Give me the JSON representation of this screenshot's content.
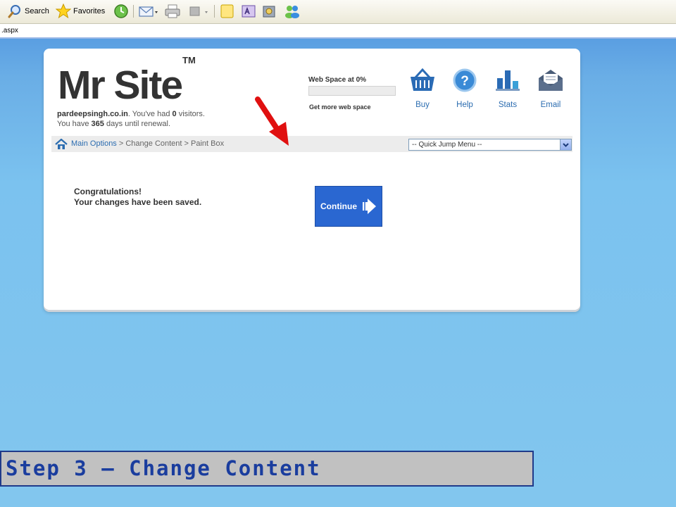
{
  "toolbar": {
    "search_label": "Search",
    "favorites_label": "Favorites"
  },
  "address": {
    "url_fragment": ".aspx"
  },
  "site": {
    "logo_text": "Mr Site",
    "logo_tm": "TM",
    "domain": "pardeepsingh.co.in",
    "visitors_prefix": ". You've had ",
    "visitors_count": "0",
    "visitors_suffix": " visitors.",
    "renewal_prefix": "You have ",
    "renewal_days": "365",
    "renewal_suffix": " days until renewal."
  },
  "webspace": {
    "label": "Web Space at 0%",
    "percent": 0,
    "link": "Get more web space"
  },
  "nav": {
    "buy": "Buy",
    "help": "Help",
    "stats": "Stats",
    "email": "Email"
  },
  "breadcrumb": {
    "home": "Main Options",
    "sep1": " > ",
    "section": "Change Content",
    "sep2": " > ",
    "page": "Paint Box"
  },
  "jump_menu": {
    "selected": "-- Quick Jump Menu --"
  },
  "message": {
    "line1": "Congratulations!",
    "line2": "Your changes have been saved."
  },
  "continue_button": "Continue",
  "step_caption": "Step 3 – Change Content",
  "colors": {
    "accent": "#2a67d1",
    "link": "#2b6cb0",
    "arrow": "#e01010"
  }
}
